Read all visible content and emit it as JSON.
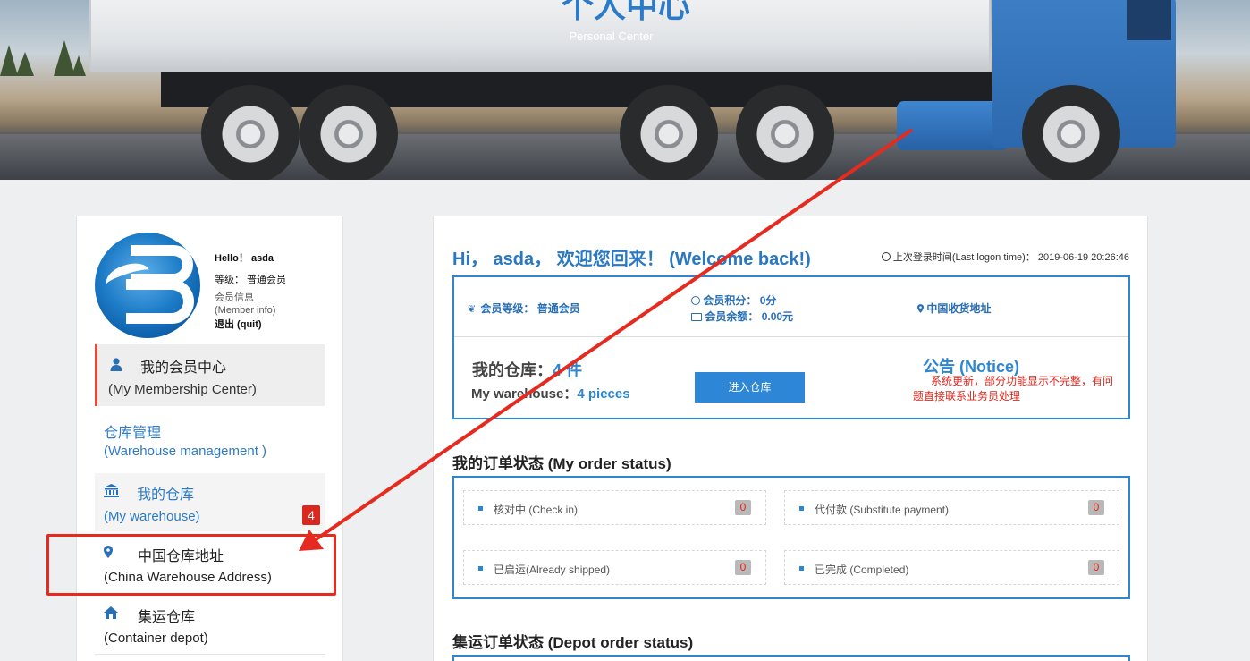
{
  "banner": {
    "title": "个人中心",
    "subtitle": "Personal Center"
  },
  "user": {
    "hello": "Hello！ asda",
    "level": "等级： 普通会员",
    "member_info_zh": "会员信息",
    "member_info_en": "(Member info)",
    "quit": "退出 (quit)"
  },
  "sidebar": {
    "items": [
      {
        "zh": "我的会员中心",
        "en": "(My Membership Center)",
        "icon": "user-icon"
      },
      {
        "zh": "仓库管理",
        "en": "(Warehouse management )"
      },
      {
        "zh": "我的仓库",
        "en": "(My warehouse)",
        "icon": "bank-icon",
        "badge": "4"
      },
      {
        "zh": "中国仓库地址",
        "en": "(China Warehouse Address)",
        "icon": "map-marker-icon"
      },
      {
        "zh": "集运仓库",
        "en": "(Container depot)",
        "icon": "home-icon"
      }
    ]
  },
  "main": {
    "welcome": "Hi， asda， 欢迎您回来！ (Welcome back!)",
    "last_login_label": "上次登录时间(Last logon time)：",
    "last_login_time": "2019-06-19 20:26:46",
    "info": {
      "level_label": "会员等级：",
      "level_value": "普通会员",
      "points_label": "会员积分：",
      "points_value": "0分",
      "balance_label": "会员余额：",
      "balance_value": "0.00元",
      "address_label": "中国收货地址"
    },
    "warehouse": {
      "zh_label": "我的仓库：",
      "zh_count": "4 件",
      "en_label": "My warehouse：",
      "en_count": "4 pieces",
      "enter_button": "进入仓库"
    },
    "notice": {
      "title": "公告 (Notice)",
      "body": "系统更新，部分功能显示不完整，有问题直接联系业务员处理"
    },
    "order_status_title": "我的订单状态 (My order status)",
    "order_status": [
      {
        "label": "核对中 (Check in)",
        "count": "0"
      },
      {
        "label": "代付款 (Substitute payment)",
        "count": "0"
      },
      {
        "label": "已启运(Already shipped)",
        "count": "0"
      },
      {
        "label": "已完成 (Completed)",
        "count": "0"
      }
    ],
    "depot_status_title": "集运订单状态 (Depot order status)"
  },
  "colors": {
    "accent": "#2d86d0",
    "active_bar": "#e54a3b",
    "annotation": "#e52b20",
    "badge": "#d9281e"
  }
}
